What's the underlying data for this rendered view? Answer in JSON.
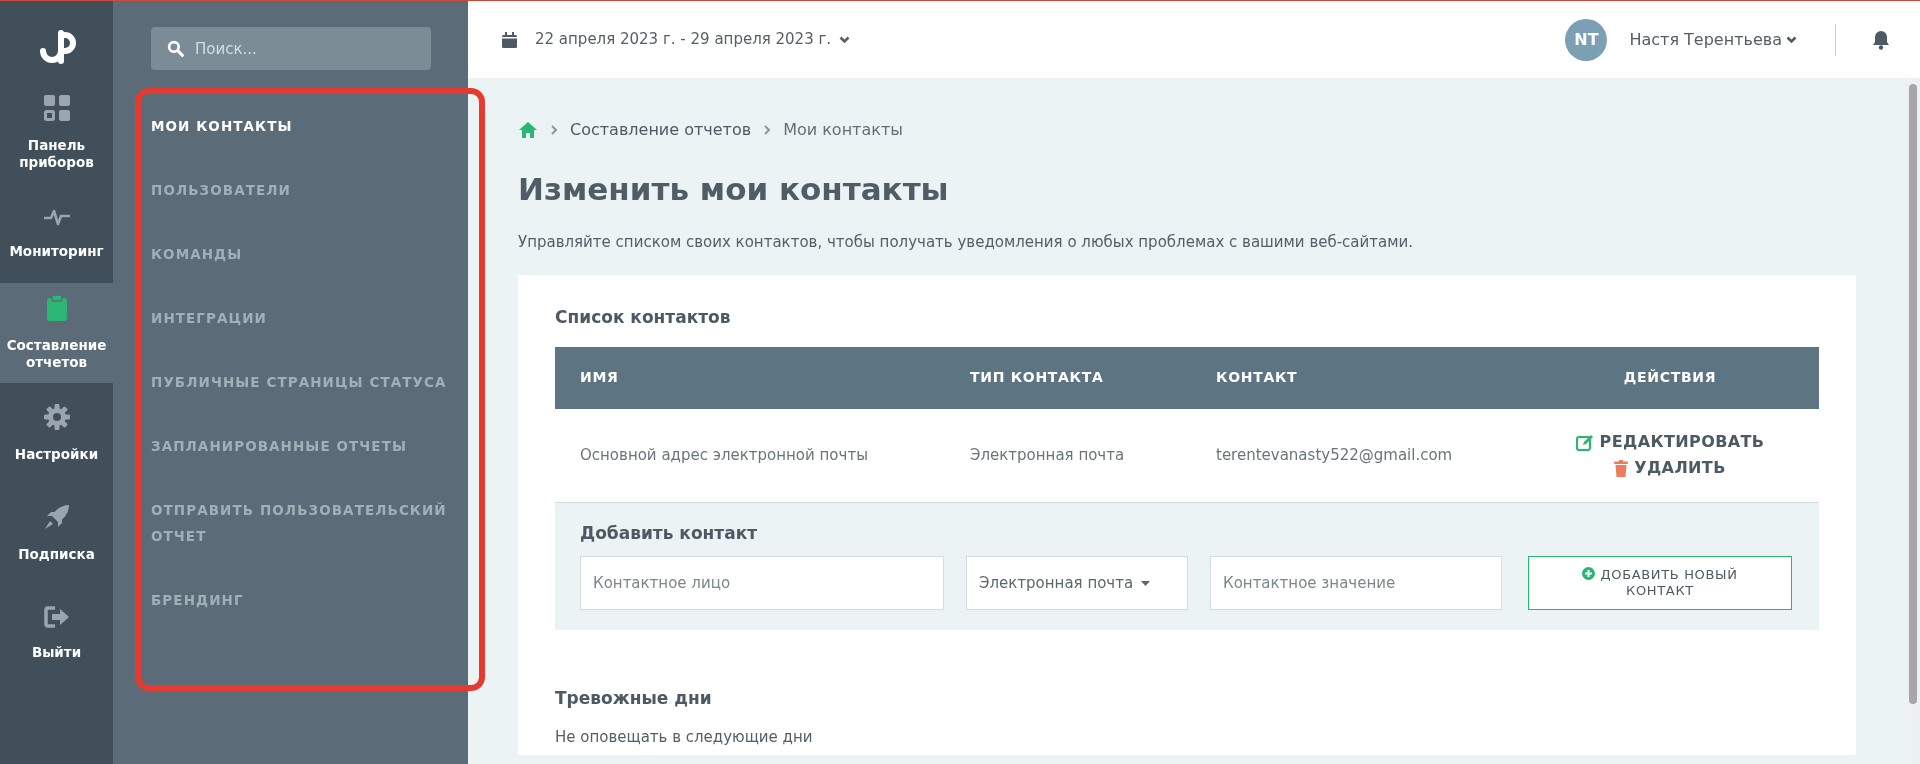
{
  "search": {
    "placeholder": "Поиск..."
  },
  "nav": [
    {
      "label": "Панель приборов",
      "kind": "grid",
      "selected": false
    },
    {
      "label": "Мониторинг",
      "kind": "pulse",
      "selected": false
    },
    {
      "label": "Составление отчетов",
      "kind": "clipboard",
      "selected": true
    },
    {
      "label": "Настройки",
      "kind": "gear",
      "selected": false
    },
    {
      "label": "Подписка",
      "kind": "rocket",
      "selected": false
    },
    {
      "label": "Выйти",
      "kind": "logout",
      "selected": false
    }
  ],
  "submenu": [
    {
      "label": "МОИ КОНТАКТЫ",
      "selected": true
    },
    {
      "label": "ПОЛЬЗОВАТЕЛИ",
      "selected": false
    },
    {
      "label": "КОМАНДЫ",
      "selected": false
    },
    {
      "label": "ИНТЕГРАЦИИ",
      "selected": false
    },
    {
      "label": "ПУБЛИЧНЫЕ СТРАНИЦЫ СТАТУСА",
      "selected": false
    },
    {
      "label": "ЗАПЛАНИРОВАННЫЕ ОТЧЕТЫ",
      "selected": false
    },
    {
      "label": "ОТПРАВИТЬ ПОЛЬЗОВАТЕЛЬСКИЙ ОТЧЕТ",
      "selected": false
    },
    {
      "label": "БРЕНДИНГ",
      "selected": false
    }
  ],
  "date_range": "22 апреля 2023 г. - 29 апреля 2023 г.",
  "user": {
    "initials": "NT",
    "name": "Настя Терентьева"
  },
  "breadcrumb": [
    "Составление отчетов",
    "Мои контакты"
  ],
  "title": "Изменить мои контакты",
  "description": "Управляйте списком своих контактов, чтобы получать уведомления о любых проблемах с вашими веб-сайтами.",
  "contacts": {
    "title": "Список контактов",
    "columns": [
      "ИМЯ",
      "ТИП КОНТАКТА",
      "КОНТАКТ",
      "ДЕЙСТВИЯ"
    ],
    "rows": [
      {
        "name": "Основной адрес электронной почты",
        "type": "Электронная почта",
        "contact": "terentevanasty522@gmail.com",
        "actions": [
          "РЕДАКТИРОВАТЬ",
          "УДАЛИТЬ"
        ]
      }
    ]
  },
  "add_contact": {
    "title": "Добавить контакт",
    "name_placeholder": "Контактное лицо",
    "type_value": "Электронная почта",
    "value_placeholder": "Контактное значение",
    "button": "ДОБАВИТЬ НОВЫЙ КОНТАКТ"
  },
  "alert_days": {
    "title": "Тревожные дни",
    "text": "Не оповещать в следующие дни"
  }
}
